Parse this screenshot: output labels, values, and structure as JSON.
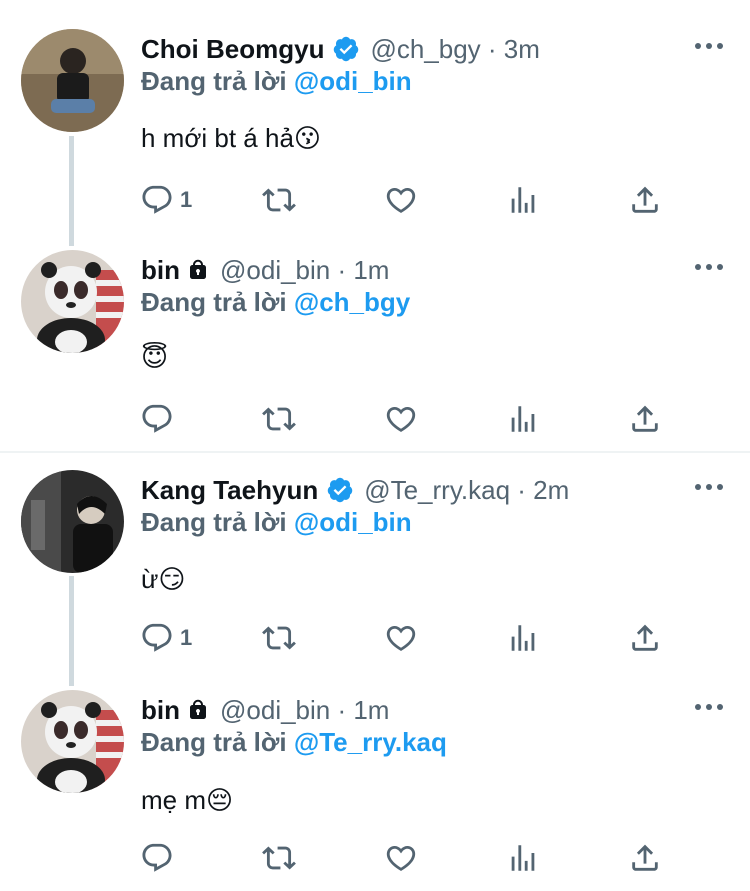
{
  "reply_prefix": "Đang trả lời",
  "threads": [
    {
      "tweets": [
        {
          "name": "Choi Beomgyu",
          "verified": true,
          "locked": false,
          "handle": "@ch_bgy",
          "time": "3m",
          "meta": "@ch_bgy · 3m",
          "reply_to": "@odi_bin",
          "text": "h mới bt á hả😗",
          "reply_count": "1",
          "avatar": "boy-sitting-photo"
        },
        {
          "name": "bin",
          "verified": false,
          "locked": true,
          "handle": "@odi_bin",
          "time": "1m",
          "meta": "@odi_bin · 1m",
          "reply_to": "@ch_bgy",
          "text": "😇",
          "reply_count": "",
          "avatar": "panda-mascot-photo"
        }
      ]
    },
    {
      "tweets": [
        {
          "name": "Kang Taehyun",
          "verified": true,
          "locked": false,
          "handle": "@Te_rry.kaq",
          "time": "2m",
          "meta": "@Te_rry.kaq · 2m",
          "reply_to": "@odi_bin",
          "text": "ừ😏",
          "reply_count": "1",
          "avatar": "dark-portrait-photo"
        },
        {
          "name": "bin",
          "verified": false,
          "locked": true,
          "handle": "@odi_bin",
          "time": "1m",
          "meta": "@odi_bin · 1m",
          "reply_to": "@Te_rry.kaq",
          "text": "mẹ m😔",
          "reply_count": "",
          "avatar": "panda-mascot-photo"
        }
      ]
    }
  ],
  "colors": {
    "accent": "#1d9bf0",
    "secondary_text": "#536471",
    "primary_text": "#0f1419",
    "thread_line": "#cfd9de"
  },
  "action_icons": [
    "reply-icon",
    "retweet-icon",
    "like-icon",
    "analytics-icon",
    "share-icon"
  ]
}
